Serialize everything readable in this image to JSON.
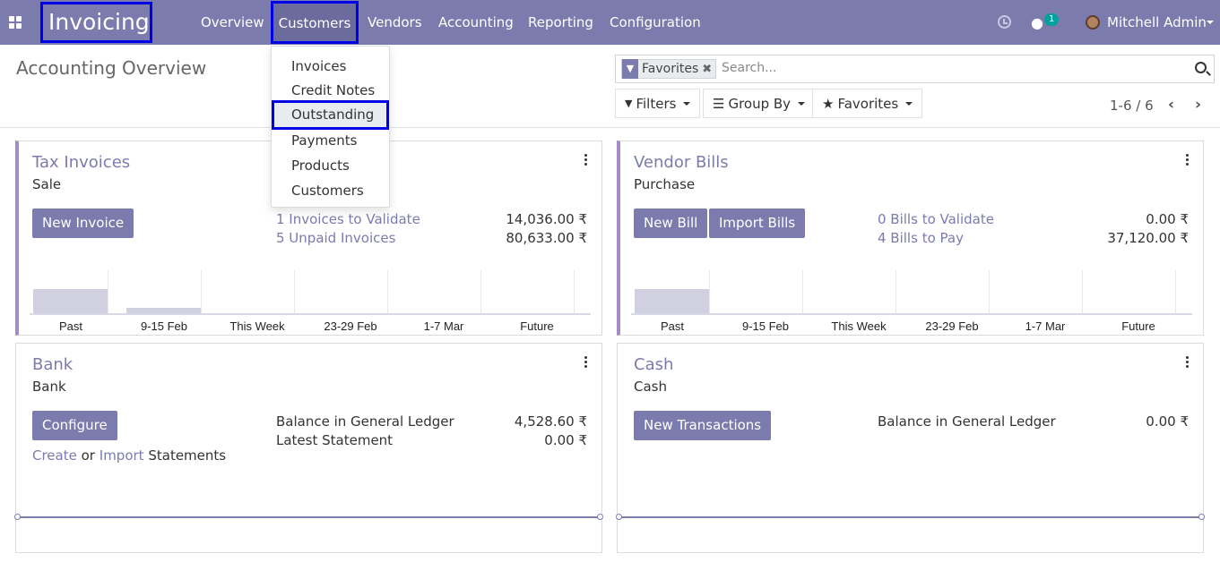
{
  "navbar": {
    "brand": "Invoicing",
    "menu": [
      "Overview",
      "Customers",
      "Vendors",
      "Accounting",
      "Reporting",
      "Configuration"
    ],
    "chat_count": "1",
    "user": "Mitchell Admin"
  },
  "dropdown": {
    "items": [
      "Invoices",
      "Credit Notes",
      "Outstanding",
      "Payments",
      "Products",
      "Customers"
    ],
    "highlighted": "Outstanding"
  },
  "control_panel": {
    "title": "Accounting Overview",
    "facet": "Favorites",
    "search_placeholder": "Search...",
    "filters_label": "Filters",
    "groupby_label": "Group By",
    "favorites_label": "Favorites",
    "pager": "1-6 / 6"
  },
  "cards": {
    "tax_invoices": {
      "title": "Tax Invoices",
      "subtitle": "Sale",
      "button": "New Invoice",
      "links": [
        "1 Invoices to Validate",
        "5 Unpaid Invoices"
      ],
      "values": [
        "14,036.00 ₹",
        "80,633.00 ₹"
      ],
      "bar_labels": [
        "Past",
        "9-15 Feb",
        "This Week",
        "23-29 Feb",
        "1-7 Mar",
        "Future"
      ],
      "bar_levels": [
        0.76,
        0.2,
        0.0,
        0.0,
        0.0,
        0.02
      ]
    },
    "vendor_bills": {
      "title": "Vendor Bills",
      "subtitle": "Purchase",
      "buttons": [
        "New Bill",
        "Import Bills"
      ],
      "links": [
        "0 Bills to Validate",
        "4 Bills to Pay"
      ],
      "values": [
        "0.00 ₹",
        "37,120.00 ₹"
      ],
      "bar_labels": [
        "Past",
        "9-15 Feb",
        "This Week",
        "23-29 Feb",
        "1-7 Mar",
        "Future"
      ],
      "bar_levels": [
        0.76,
        0.0,
        0.0,
        0.0,
        0.0,
        0.0
      ]
    },
    "bank": {
      "title": "Bank",
      "subtitle": "Bank",
      "button": "Configure",
      "create_link": "Create",
      "or_text": "or",
      "import_link": "Import",
      "statements_text": "Statements",
      "labels": [
        "Balance in General Ledger",
        "Latest Statement"
      ],
      "values": [
        "4,528.60 ₹",
        "0.00 ₹"
      ]
    },
    "cash": {
      "title": "Cash",
      "subtitle": "Cash",
      "button": "New Transactions",
      "labels": [
        "Balance in General Ledger"
      ],
      "values": [
        "0.00 ₹"
      ]
    }
  },
  "colors": {
    "brand": "#7c7bad",
    "highlight_border": "#0000e6",
    "accent_border": "#a58bc8"
  }
}
